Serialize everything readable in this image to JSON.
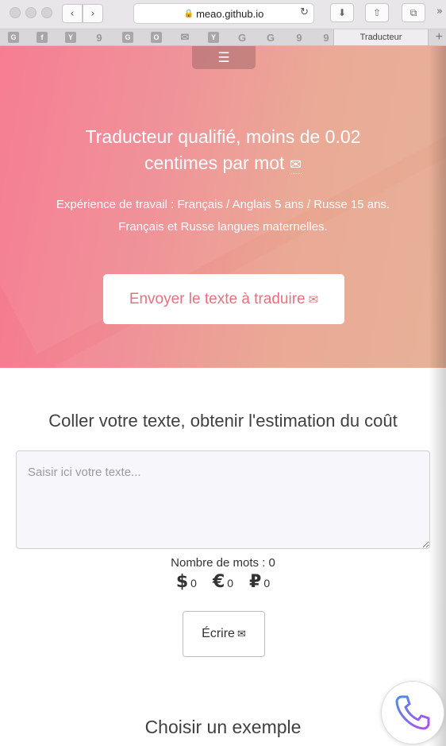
{
  "browser": {
    "url": "meao.github.io",
    "back_icon": "‹",
    "forward_icon": "›",
    "lock_icon": "🔒",
    "reload_icon": "↻",
    "download_icon": "⬇",
    "share_icon": "⇧",
    "tabs_icon": "⧉",
    "more_icon": "»",
    "tab_title": "Traducteur",
    "new_tab_icon": "+"
  },
  "bookmarks": [
    {
      "glyph": "G",
      "name": "google"
    },
    {
      "glyph": "f",
      "name": "facebook"
    },
    {
      "glyph": "Y",
      "name": "ycombinator"
    },
    {
      "glyph": "9",
      "name": "nine"
    },
    {
      "glyph": "G",
      "name": "google-2"
    },
    {
      "glyph": "O",
      "name": "o"
    },
    {
      "glyph": "✉",
      "name": "mail"
    },
    {
      "glyph": "Y",
      "name": "yandex"
    },
    {
      "glyph": "G",
      "name": "google-3"
    },
    {
      "glyph": "G",
      "name": "google-4"
    },
    {
      "glyph": "9",
      "name": "nine-2"
    },
    {
      "glyph": "9",
      "name": "nine-3"
    }
  ],
  "hero": {
    "menu_icon": "☰",
    "title": "Traducteur qualifié, moins de 0.02 centimes par mot",
    "title_icon": "✉",
    "experience": "Expérience de travail : Français / Anglais 5 ans / Russe 15 ans.",
    "languages": "Français et Russe langues maternelles.",
    "cta_label": "Envoyer le texte à traduire",
    "cta_icon": "✉"
  },
  "estimate": {
    "title": "Coller votre texte, obtenir l'estimation du coût",
    "placeholder": "Saisir ici votre texte...",
    "value": "",
    "word_count": "Nombre de mots : 0",
    "prices": [
      {
        "symbol": "$",
        "amount": "0",
        "name": "usd"
      },
      {
        "symbol": "€",
        "amount": "0",
        "name": "eur"
      },
      {
        "symbol": "₽",
        "amount": "0",
        "name": "rub"
      }
    ],
    "write_label": "Écrire",
    "write_icon": "✉"
  },
  "examples": {
    "title": "Choisir un exemple"
  },
  "colors": {
    "hero_start": "#f6768d",
    "hero_end": "#e6ad93",
    "cta_text": "#e9717d",
    "phone_gradient_start": "#4a8cf0",
    "phone_gradient_end": "#b44cf0"
  },
  "phone": {
    "icon": "phone-icon"
  }
}
